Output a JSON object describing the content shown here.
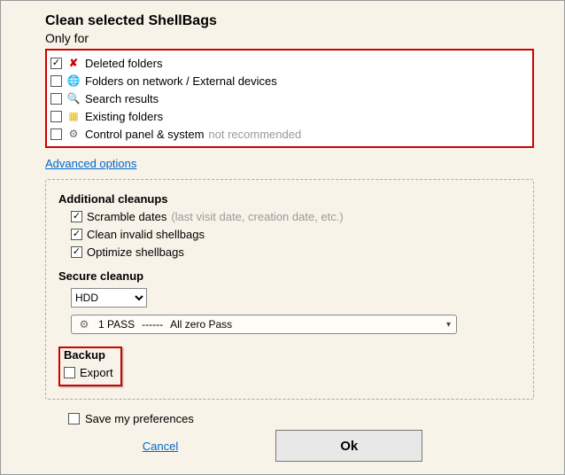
{
  "title": "Clean selected ShellBags",
  "only_for": "Only for",
  "filters": [
    {
      "checked": true,
      "icon": "delete-x",
      "label": "Deleted folders"
    },
    {
      "checked": false,
      "icon": "globe",
      "label": "Folders on network / External devices"
    },
    {
      "checked": false,
      "icon": "magnifier",
      "label": "Search results"
    },
    {
      "checked": false,
      "icon": "folder",
      "label": "Existing folders"
    },
    {
      "checked": false,
      "icon": "gear",
      "label": "Control panel & system",
      "note": "not recommended"
    }
  ],
  "advanced_link": "Advanced options",
  "additional": {
    "heading": "Additional cleanups",
    "items": [
      {
        "checked": true,
        "label": "Scramble dates ",
        "note": "(last visit date, creation date, etc.)"
      },
      {
        "checked": true,
        "label": "Clean invalid shellbags"
      },
      {
        "checked": true,
        "label": "Optimize shellbags"
      }
    ]
  },
  "secure": {
    "heading": "Secure cleanup",
    "drive": "HDD",
    "pass_label": "1 PASS",
    "pass_sep": "------",
    "pass_desc": "All zero Pass"
  },
  "backup": {
    "heading": "Backup",
    "export_checked": false,
    "export_label": "Export"
  },
  "save_pref": {
    "checked": false,
    "label": "Save my preferences"
  },
  "buttons": {
    "cancel": "Cancel",
    "ok": "Ok"
  }
}
